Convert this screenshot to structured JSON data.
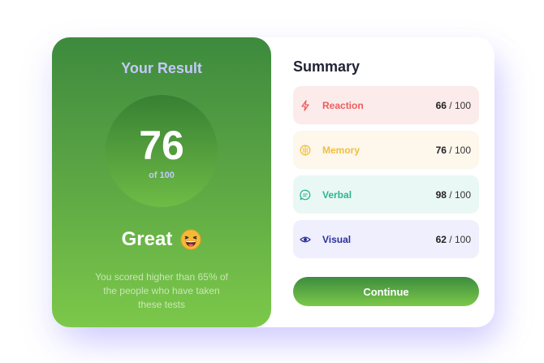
{
  "result": {
    "title": "Your Result",
    "score": "76",
    "of_label": "of 100",
    "rating": "Great",
    "emoji_icon": "laughing-face-emoji",
    "description": "You scored higher than 65% of the people who have taken these tests"
  },
  "summary": {
    "title": "Summary",
    "items": [
      {
        "label": "Reaction",
        "score": "66",
        "max": " / 100",
        "icon": "lightning-icon",
        "color": "#ee5c5c",
        "bg": "#fcebeb"
      },
      {
        "label": "Memory",
        "score": "76",
        "max": " / 100",
        "icon": "brain-icon",
        "color": "#f2bf3b",
        "bg": "#fdf7ec"
      },
      {
        "label": "Verbal",
        "score": "98",
        "max": " / 100",
        "icon": "chat-bubble-icon",
        "color": "#2bb690",
        "bg": "#eaf8f5"
      },
      {
        "label": "Visual",
        "score": "62",
        "max": " / 100",
        "icon": "eye-icon",
        "color": "#2d2f9c",
        "bg": "#efeffd"
      }
    ],
    "continue_label": "Continue"
  },
  "colors": {
    "accent_green_dark": "#3d8a3e",
    "accent_green_light": "#7cc84a",
    "lavender_text": "#c6c8ff"
  }
}
